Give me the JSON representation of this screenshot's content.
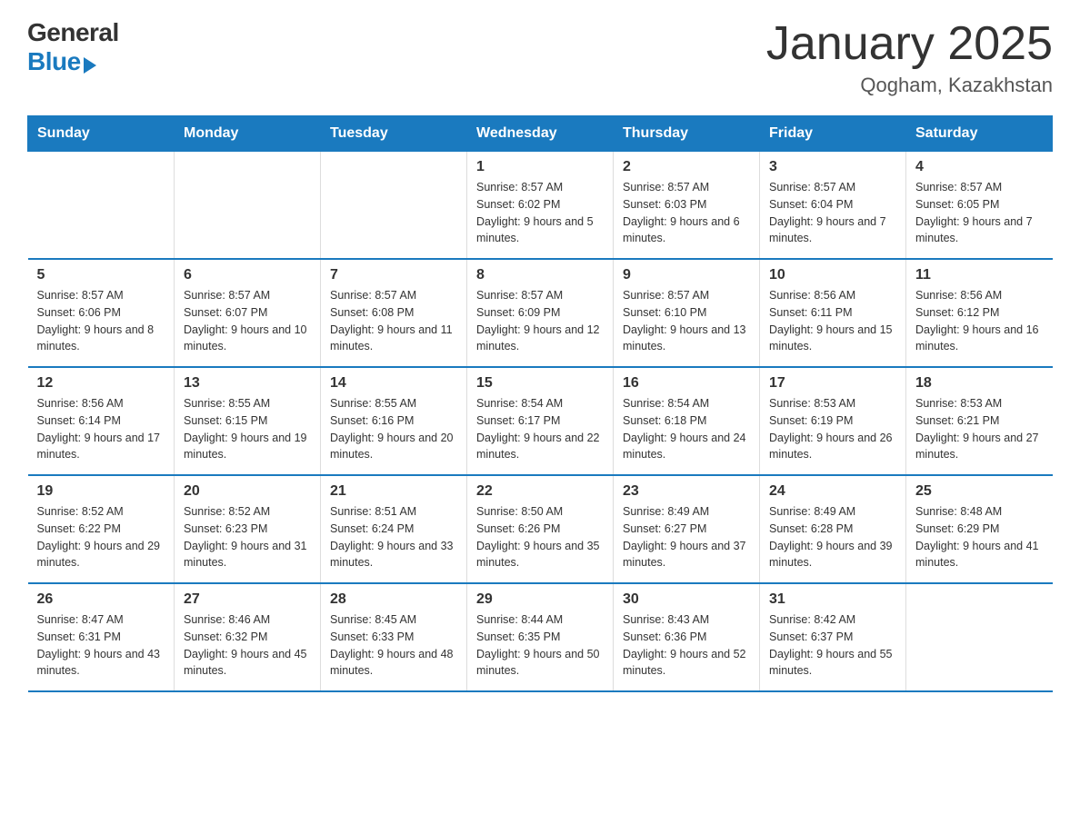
{
  "header": {
    "logo_line1": "General",
    "logo_line2": "Blue",
    "title": "January 2025",
    "subtitle": "Qogham, Kazakhstan"
  },
  "calendar": {
    "days_of_week": [
      "Sunday",
      "Monday",
      "Tuesday",
      "Wednesday",
      "Thursday",
      "Friday",
      "Saturday"
    ],
    "weeks": [
      [
        {
          "day": "",
          "info": ""
        },
        {
          "day": "",
          "info": ""
        },
        {
          "day": "",
          "info": ""
        },
        {
          "day": "1",
          "info": "Sunrise: 8:57 AM\nSunset: 6:02 PM\nDaylight: 9 hours and 5 minutes."
        },
        {
          "day": "2",
          "info": "Sunrise: 8:57 AM\nSunset: 6:03 PM\nDaylight: 9 hours and 6 minutes."
        },
        {
          "day": "3",
          "info": "Sunrise: 8:57 AM\nSunset: 6:04 PM\nDaylight: 9 hours and 7 minutes."
        },
        {
          "day": "4",
          "info": "Sunrise: 8:57 AM\nSunset: 6:05 PM\nDaylight: 9 hours and 7 minutes."
        }
      ],
      [
        {
          "day": "5",
          "info": "Sunrise: 8:57 AM\nSunset: 6:06 PM\nDaylight: 9 hours and 8 minutes."
        },
        {
          "day": "6",
          "info": "Sunrise: 8:57 AM\nSunset: 6:07 PM\nDaylight: 9 hours and 10 minutes."
        },
        {
          "day": "7",
          "info": "Sunrise: 8:57 AM\nSunset: 6:08 PM\nDaylight: 9 hours and 11 minutes."
        },
        {
          "day": "8",
          "info": "Sunrise: 8:57 AM\nSunset: 6:09 PM\nDaylight: 9 hours and 12 minutes."
        },
        {
          "day": "9",
          "info": "Sunrise: 8:57 AM\nSunset: 6:10 PM\nDaylight: 9 hours and 13 minutes."
        },
        {
          "day": "10",
          "info": "Sunrise: 8:56 AM\nSunset: 6:11 PM\nDaylight: 9 hours and 15 minutes."
        },
        {
          "day": "11",
          "info": "Sunrise: 8:56 AM\nSunset: 6:12 PM\nDaylight: 9 hours and 16 minutes."
        }
      ],
      [
        {
          "day": "12",
          "info": "Sunrise: 8:56 AM\nSunset: 6:14 PM\nDaylight: 9 hours and 17 minutes."
        },
        {
          "day": "13",
          "info": "Sunrise: 8:55 AM\nSunset: 6:15 PM\nDaylight: 9 hours and 19 minutes."
        },
        {
          "day": "14",
          "info": "Sunrise: 8:55 AM\nSunset: 6:16 PM\nDaylight: 9 hours and 20 minutes."
        },
        {
          "day": "15",
          "info": "Sunrise: 8:54 AM\nSunset: 6:17 PM\nDaylight: 9 hours and 22 minutes."
        },
        {
          "day": "16",
          "info": "Sunrise: 8:54 AM\nSunset: 6:18 PM\nDaylight: 9 hours and 24 minutes."
        },
        {
          "day": "17",
          "info": "Sunrise: 8:53 AM\nSunset: 6:19 PM\nDaylight: 9 hours and 26 minutes."
        },
        {
          "day": "18",
          "info": "Sunrise: 8:53 AM\nSunset: 6:21 PM\nDaylight: 9 hours and 27 minutes."
        }
      ],
      [
        {
          "day": "19",
          "info": "Sunrise: 8:52 AM\nSunset: 6:22 PM\nDaylight: 9 hours and 29 minutes."
        },
        {
          "day": "20",
          "info": "Sunrise: 8:52 AM\nSunset: 6:23 PM\nDaylight: 9 hours and 31 minutes."
        },
        {
          "day": "21",
          "info": "Sunrise: 8:51 AM\nSunset: 6:24 PM\nDaylight: 9 hours and 33 minutes."
        },
        {
          "day": "22",
          "info": "Sunrise: 8:50 AM\nSunset: 6:26 PM\nDaylight: 9 hours and 35 minutes."
        },
        {
          "day": "23",
          "info": "Sunrise: 8:49 AM\nSunset: 6:27 PM\nDaylight: 9 hours and 37 minutes."
        },
        {
          "day": "24",
          "info": "Sunrise: 8:49 AM\nSunset: 6:28 PM\nDaylight: 9 hours and 39 minutes."
        },
        {
          "day": "25",
          "info": "Sunrise: 8:48 AM\nSunset: 6:29 PM\nDaylight: 9 hours and 41 minutes."
        }
      ],
      [
        {
          "day": "26",
          "info": "Sunrise: 8:47 AM\nSunset: 6:31 PM\nDaylight: 9 hours and 43 minutes."
        },
        {
          "day": "27",
          "info": "Sunrise: 8:46 AM\nSunset: 6:32 PM\nDaylight: 9 hours and 45 minutes."
        },
        {
          "day": "28",
          "info": "Sunrise: 8:45 AM\nSunset: 6:33 PM\nDaylight: 9 hours and 48 minutes."
        },
        {
          "day": "29",
          "info": "Sunrise: 8:44 AM\nSunset: 6:35 PM\nDaylight: 9 hours and 50 minutes."
        },
        {
          "day": "30",
          "info": "Sunrise: 8:43 AM\nSunset: 6:36 PM\nDaylight: 9 hours and 52 minutes."
        },
        {
          "day": "31",
          "info": "Sunrise: 8:42 AM\nSunset: 6:37 PM\nDaylight: 9 hours and 55 minutes."
        },
        {
          "day": "",
          "info": ""
        }
      ]
    ]
  }
}
